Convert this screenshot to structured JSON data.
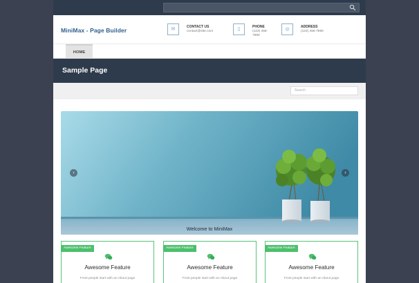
{
  "site": {
    "logo": "MiniMax - Page Builder"
  },
  "topbar": {
    "search_icon": "search-icon"
  },
  "contacts": [
    {
      "icon": "email-icon",
      "glyph": "✉",
      "title": "CONTACT US",
      "line1": "contact@site.com",
      "line2": ""
    },
    {
      "icon": "phone-icon",
      "glyph": "▯",
      "title": "PHONE",
      "line1": "(123) 456-",
      "line2": "7890"
    },
    {
      "icon": "location-icon",
      "glyph": "◎",
      "title": "ADDRESS",
      "line1": "(123) 456-7890",
      "line2": ""
    }
  ],
  "nav": {
    "items": [
      {
        "label": "HOME"
      }
    ]
  },
  "banner": {
    "title": "Sample Page"
  },
  "search": {
    "placeholder": "Search"
  },
  "slider": {
    "caption": "Welcome to MiniMax",
    "prev_glyph": "‹",
    "next_glyph": "›"
  },
  "features": [
    {
      "badge": "Awesome Feature",
      "title": "Awesome Feature",
      "text": "Frost people start with an About page"
    },
    {
      "badge": "Awesome Feature",
      "title": "Awesome Feature",
      "text": "Frost people start with an About page"
    },
    {
      "badge": "Awesome Feature",
      "title": "Awesome Feature",
      "text": "Frost people start with an About page"
    }
  ],
  "colors": {
    "page_bg": "#3b4150",
    "navy": "#2e3b4c",
    "accent_green": "#4cc06c",
    "logo_blue": "#2f5f8f"
  }
}
